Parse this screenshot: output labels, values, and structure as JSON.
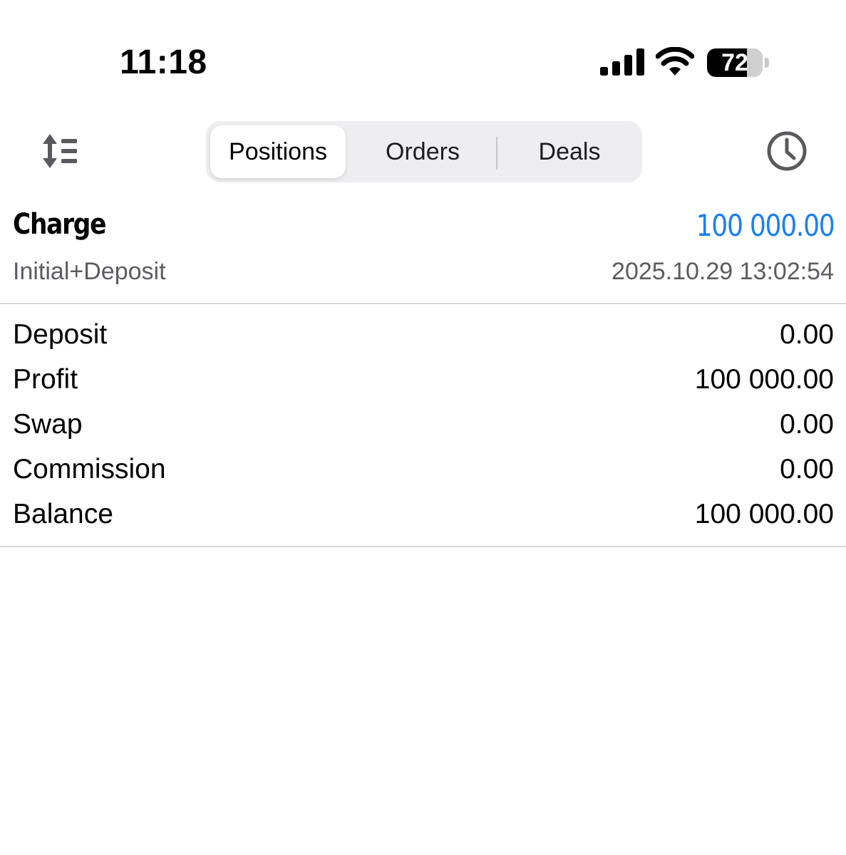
{
  "status_bar": {
    "time": "11:18",
    "battery_level": "72",
    "battery_fraction": 0.72,
    "icons": [
      "cellular-signal-icon",
      "wifi-icon",
      "battery-icon"
    ]
  },
  "toolbar": {
    "sort_icon": "sort-icon",
    "history_icon": "clock-icon",
    "tabs": [
      {
        "label": "Positions",
        "active": true
      },
      {
        "label": "Orders",
        "active": false
      },
      {
        "label": "Deals",
        "active": false
      }
    ]
  },
  "deal": {
    "title": "Charge",
    "amount": "100 000.00",
    "comment": "Initial+Deposit",
    "timestamp": "2025.10.29 13:02:54"
  },
  "summary": [
    {
      "label": "Deposit",
      "value": "0.00"
    },
    {
      "label": "Profit",
      "value": "100 000.00"
    },
    {
      "label": "Swap",
      "value": "0.00"
    },
    {
      "label": "Commission",
      "value": "0.00"
    },
    {
      "label": "Balance",
      "value": "100 000.00"
    }
  ],
  "colors": {
    "accent": "#1a7ff0",
    "secondary_text": "#5c5c60",
    "segment_bg": "#eeeef0",
    "divider": "#d8d8da"
  }
}
